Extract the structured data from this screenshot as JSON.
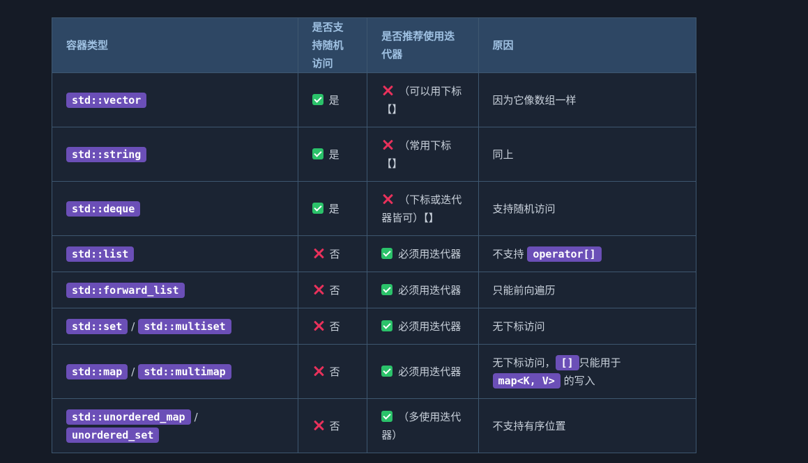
{
  "headers": {
    "type": "容器类型",
    "random": "是否支持随机访问",
    "iter": "是否推荐使用迭代器",
    "reason": "原因"
  },
  "rows": [
    {
      "names": [
        "std::vector"
      ],
      "random": "是",
      "iter": "（可以用下标【】",
      "reason_pre": "因为它像数组一样"
    },
    {
      "names": [
        "std::string"
      ],
      "random": "是",
      "iter": "（常用下标【】",
      "reason_pre": "同上"
    },
    {
      "names": [
        "std::deque"
      ],
      "random": "是",
      "iter": "（下标或迭代器皆可）【】",
      "reason_pre": "支持随机访问"
    },
    {
      "names": [
        "std::list"
      ],
      "random": "否",
      "iter": "必须用迭代器",
      "reason_pre": "不支持",
      "reason_code1": "operator[]"
    },
    {
      "names": [
        "std::forward_list"
      ],
      "random": "否",
      "iter": "必须用迭代器",
      "reason_pre": "只能前向遍历"
    },
    {
      "names": [
        "std::set",
        "std::multiset"
      ],
      "random": "否",
      "iter": "必须用迭代器",
      "reason_pre": "无下标访问"
    },
    {
      "names": [
        "std::map",
        "std::multimap"
      ],
      "random": "否",
      "iter": "必须用迭代器",
      "reason_pre": "无下标访问，",
      "reason_code1": "[]",
      "reason_mid": "只能用于",
      "reason_code2": "map<K, V>",
      "reason_post": "的写入"
    },
    {
      "names": [
        "std::unordered_map",
        "unordered_set"
      ],
      "random": "否",
      "iter": "（多使用迭代器）",
      "reason_pre": "不支持有序位置"
    }
  ],
  "separator": "/",
  "icons": {
    "yes": "check-box-icon",
    "no": "cross-icon"
  },
  "colors": {
    "background": "#151b26",
    "header_bg": "#2e4764",
    "row_bg": "#1b2433",
    "code_bg": "#6b4fb7",
    "check": "#2bc26a",
    "cross": "#e8315b"
  }
}
